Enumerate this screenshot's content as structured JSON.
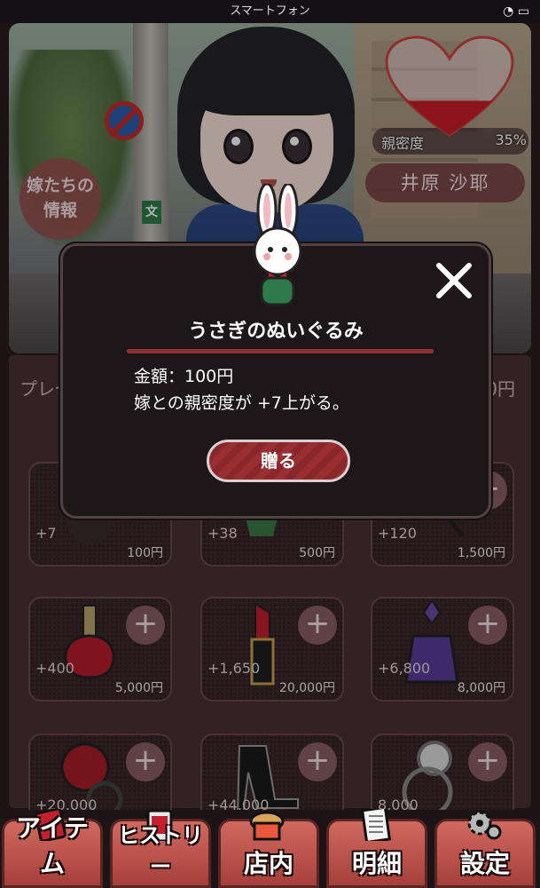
{
  "status_bar": {
    "title": "スマートフォン",
    "icons": "wifi-icon battery-icon"
  },
  "heroine": {
    "name": "井原 沙耶",
    "affection_label": "親密度",
    "affection_value": "35%",
    "affection_level": 0.35
  },
  "info_button": {
    "line1": "嫁たちの",
    "line2": "情報"
  },
  "present_row": {
    "label": "プレゼントアイ",
    "cost": "500円"
  },
  "items": [
    {
      "affinity": "+7",
      "price": "100円",
      "icon": "bunny-plush-icon"
    },
    {
      "affinity": "+38",
      "price": "500円",
      "icon": "flower-pot-icon"
    },
    {
      "affinity": "+120",
      "price": "1,500円",
      "icon": "necklace-icon"
    },
    {
      "affinity": "+400",
      "price": "5,000円",
      "icon": "nail-polish-icon"
    },
    {
      "affinity": "+1,650",
      "price": "20,000円",
      "icon": "lipstick-icon"
    },
    {
      "affinity": "+6,800",
      "price": "8,000円",
      "icon": "perfume-icon"
    },
    {
      "affinity": "+20,000",
      "price": "",
      "icon": "rose-bracelet-icon"
    },
    {
      "affinity": "+44,000",
      "price": "",
      "icon": "high-heels-icon"
    },
    {
      "affinity": "8,000",
      "price": "",
      "icon": "pocket-watch-icon"
    }
  ],
  "dialog": {
    "title": "うさぎのぬいぐるみ",
    "price_line": "金額：100円",
    "effect_line": "嫁との親密度が +7上がる。",
    "gift_button": "贈る",
    "close": "×"
  },
  "tabs": [
    {
      "label": "アイテム",
      "icon": "item-icon"
    },
    {
      "label": "ヒストリー",
      "icon": "history-icon"
    },
    {
      "label": "店内",
      "icon": "shop-icon"
    },
    {
      "label": "明細",
      "icon": "receipt-icon"
    },
    {
      "label": "設定",
      "icon": "gear-icon"
    }
  ],
  "colors": {
    "accent": "#8c3131",
    "tab": "#c05a52",
    "panel": "#4a3236"
  }
}
